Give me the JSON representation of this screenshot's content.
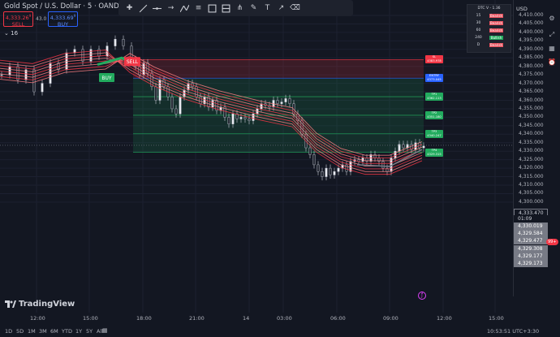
{
  "header": {
    "symbol": "Gold Spot / U.S. Dollar · 5 · OANDA",
    "sell_price": "4,333.26",
    "sell_sup": "9",
    "sell_label": "SELL",
    "spread": "43.0",
    "buy_price": "4,333.69",
    "buy_sup": "9",
    "buy_label": "BUY",
    "indicator_count": "16"
  },
  "toolbar": {
    "icons": [
      "crosshair-tool",
      "trendline-tool",
      "horizontal-line-tool",
      "arrow-line-tool",
      "vertical-line-tool",
      "path-tool",
      "rectangle-tool",
      "position-tool",
      "pitchfork-tool",
      "brush-tool",
      "text-tool",
      "arrow-tool",
      "eraser-tool"
    ]
  },
  "dtc_panel": {
    "title": "DTC V - 1.36",
    "rows": [
      {
        "tf": "15",
        "state": "Bearish"
      },
      {
        "tf": "30",
        "state": "Bearish"
      },
      {
        "tf": "60",
        "state": "Bearish"
      },
      {
        "tf": "240",
        "state": "Bullish"
      },
      {
        "tf": "D",
        "state": "Bearish"
      }
    ],
    "bearish_color": "#e8515e",
    "bullish_color": "#22ab5e"
  },
  "price_axis": {
    "currency": "USD",
    "ticks": [
      "4,410.000",
      "4,405.000",
      "4,400.000",
      "4,395.000",
      "4,390.000",
      "4,385.000",
      "4,380.000",
      "4,375.000",
      "4,370.000",
      "4,365.000",
      "4,360.000",
      "4,355.000",
      "4,350.000",
      "4,345.000",
      "4,340.000",
      "4,335.000",
      "4,330.000",
      "4,325.000",
      "4,320.000",
      "4,315.000",
      "4,310.000",
      "4,305.000",
      "4,300.000"
    ],
    "current_price": "4,333.470",
    "countdown": "01:09",
    "ma_labels": [
      "4,330.019",
      "4,329.584",
      "4,329.477",
      "4,329.308",
      "4,329.177",
      "4,329.173"
    ]
  },
  "levels": [
    {
      "name": "SL",
      "price": "4383.978",
      "color": "#f23645"
    },
    {
      "name": "ENTRY",
      "price": "4373.045",
      "color": "#2962ff"
    },
    {
      "name": "TP1",
      "price": "4362.113",
      "color": "#22ab5e"
    },
    {
      "name": "TP2",
      "price": "4351.180",
      "color": "#22ab5e"
    },
    {
      "name": "TP3",
      "price": "4340.247",
      "color": "#22ab5e"
    },
    {
      "name": "TP4",
      "price": "4329.315",
      "color": "#22ab5e"
    }
  ],
  "signals": {
    "sell": "SELL",
    "buy": "BUY"
  },
  "time_axis": {
    "labels": [
      "12:00",
      "15:00",
      "18:00",
      "21:00",
      "14",
      "03:00",
      "06:00",
      "09:00",
      "12:00",
      "15:00"
    ]
  },
  "bottom_bar": {
    "ranges": [
      "1D",
      "5D",
      "1M",
      "3M",
      "6M",
      "YTD",
      "1Y",
      "5Y",
      "All"
    ],
    "clock": "10:53:51 UTC+3:30"
  },
  "tag_badge": "99+",
  "brand": "TradingView",
  "colors": {
    "background": "#131722",
    "up": "#d1d4dc",
    "ribbon_bear": "#f23645",
    "ribbon_bull": "#22ab5e",
    "sl_zone": "#f23645",
    "tp_zone": "#22ab5e"
  }
}
